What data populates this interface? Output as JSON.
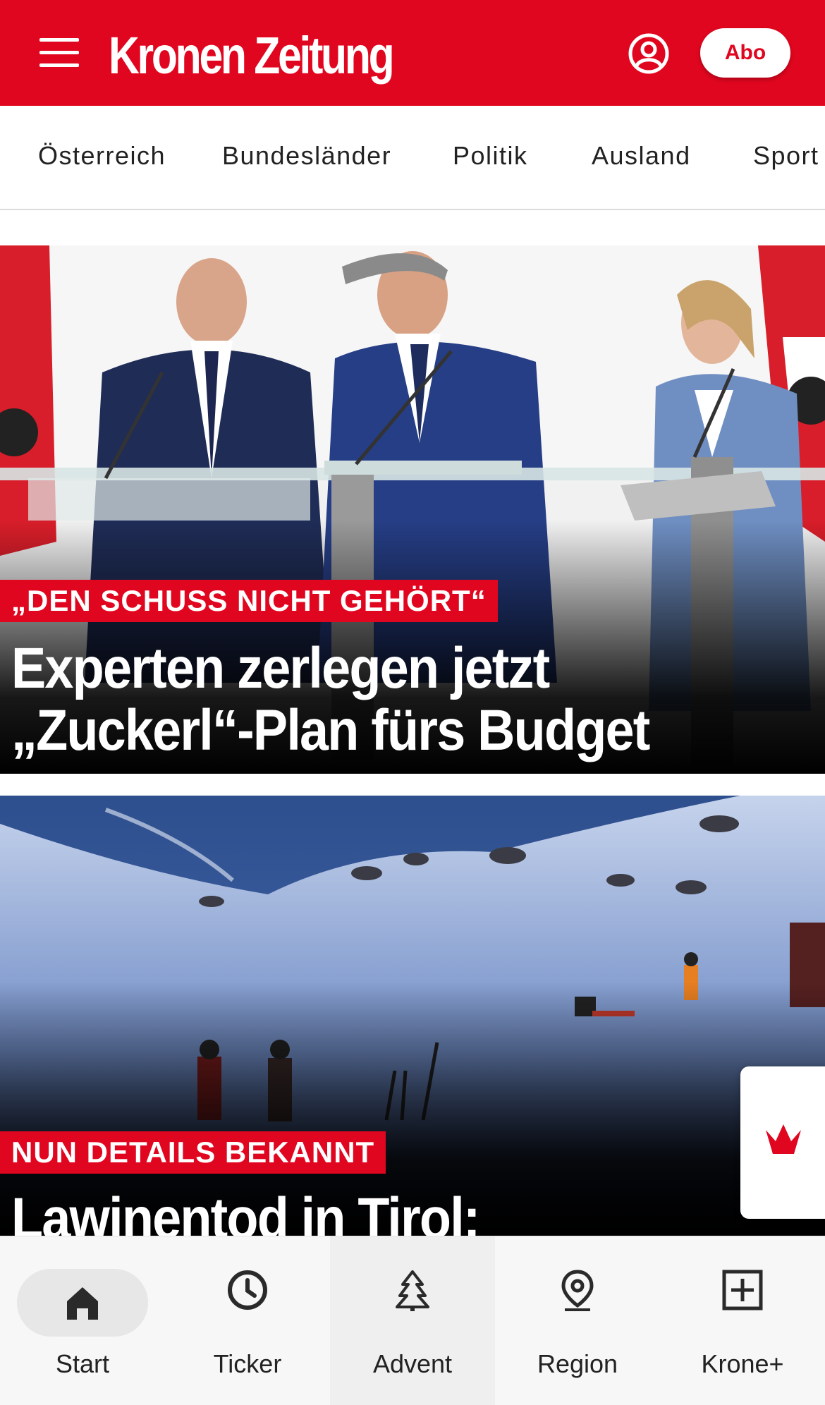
{
  "header": {
    "logo_text": "Kronen Zeitung",
    "abo_label": "Abo",
    "menu_icon": "hamburger-menu-icon",
    "user_icon": "user-account-icon"
  },
  "categories": [
    "Österreich",
    "Bundesländer",
    "Politik",
    "Ausland",
    "Sport"
  ],
  "articles": [
    {
      "kicker": "„DEN SCHUSS NICHT GEHÖRT“",
      "headline_line1": "Experten zerlegen jetzt",
      "headline_line2": "„Zuckerl“-Plan fürs Budget"
    },
    {
      "kicker": "NUN DETAILS BEKANNT",
      "headline_line1": "Lawinentod in Tirol:"
    }
  ],
  "bottom_nav": [
    {
      "label": "Start",
      "icon": "home-icon",
      "active": true
    },
    {
      "label": "Ticker",
      "icon": "clock-icon"
    },
    {
      "label": "Advent",
      "icon": "christmas-tree-icon"
    },
    {
      "label": "Region",
      "icon": "location-pin-icon"
    },
    {
      "label": "Krone+",
      "icon": "plus-box-icon"
    }
  ],
  "colors": {
    "brand_red": "#e1061f",
    "nav_background": "#f7f7f7"
  }
}
